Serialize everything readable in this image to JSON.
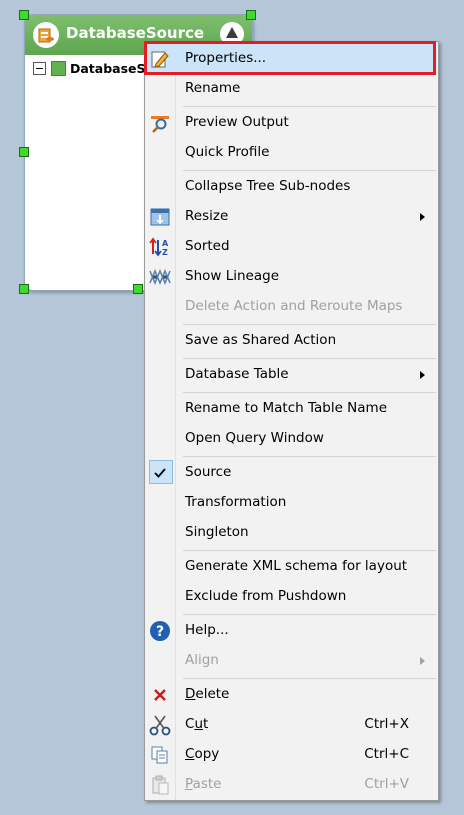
{
  "node": {
    "title": "DatabaseSource",
    "tree_label": "DatabaseS"
  },
  "menu": {
    "items": {
      "properties": "Properties...",
      "rename": "Rename",
      "preview_output": "Preview Output",
      "quick_profile": "Quick Profile",
      "collapse_tree": "Collapse Tree Sub-nodes",
      "resize": "Resize",
      "sorted": "Sorted",
      "show_lineage": "Show Lineage",
      "delete_action": "Delete Action and Reroute Maps",
      "save_shared": "Save as Shared Action",
      "database_table": "Database Table",
      "rename_match": "Rename to Match Table Name",
      "open_query": "Open Query Window",
      "source": "Source",
      "transformation": "Transformation",
      "singleton": "Singleton",
      "generate_xml": "Generate XML schema for layout",
      "exclude_pushdown": "Exclude from Pushdown",
      "help": "Help...",
      "align": "Align",
      "delete_first": "D",
      "delete_rest": "elete",
      "cut_pre": "C",
      "cut_u": "u",
      "cut_post": "t",
      "copy_first": "C",
      "copy_rest": "opy",
      "paste_first": "P",
      "paste_rest": "aste"
    },
    "shortcuts": {
      "cut": "Ctrl+X",
      "copy": "Ctrl+C",
      "paste": "Ctrl+V"
    }
  },
  "colors": {
    "highlight_border": "#e31d25",
    "selection": "#cce4f7",
    "node_header": "#6cb25c"
  }
}
